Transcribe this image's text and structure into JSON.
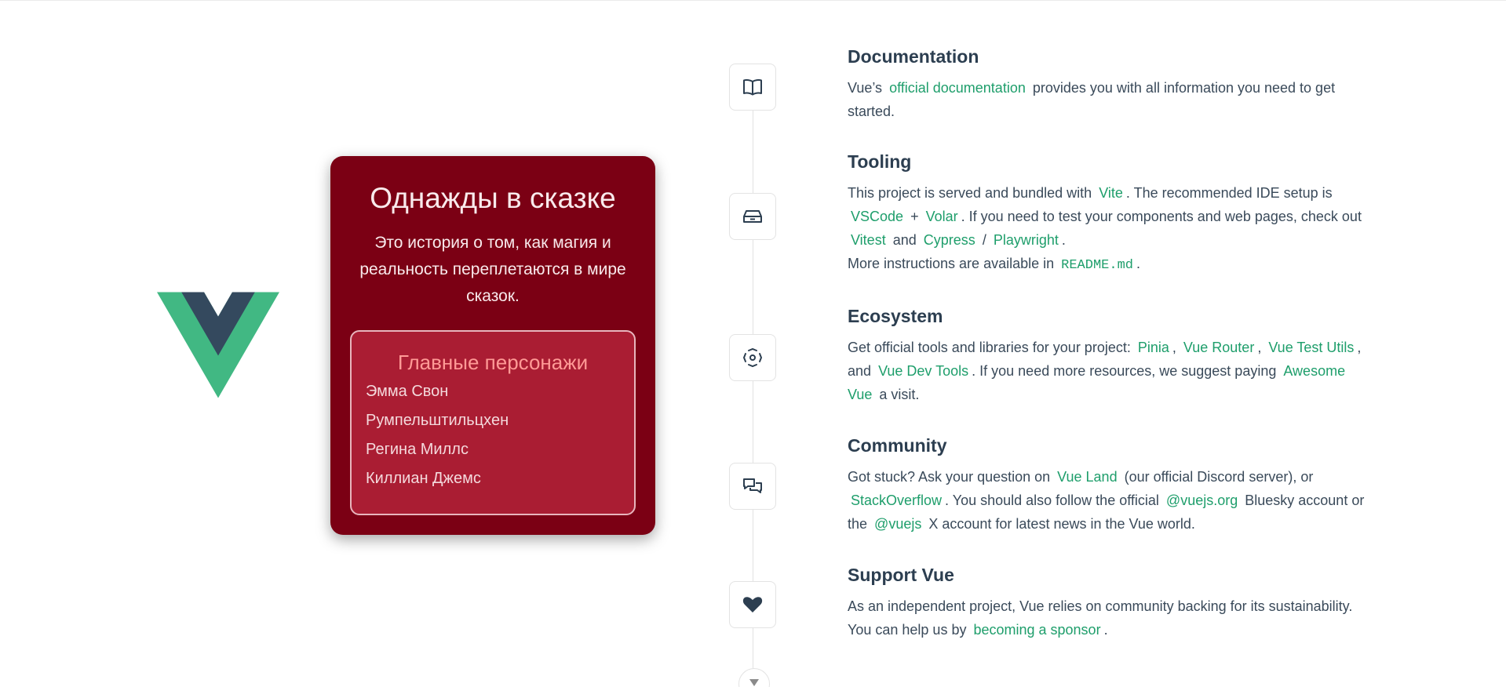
{
  "story": {
    "title": "Однажды в сказке",
    "description": "Это история о том, как магия и реальность переплетаются в мире сказок.",
    "characters_title": "Главные персонажи",
    "characters": [
      "Эмма Свон",
      "Румпельштильцхен",
      "Регина Миллс",
      "Киллиан Джемс"
    ]
  },
  "colors": {
    "card_bg": "#7b0014",
    "card_inner_bg": "#aa1d33",
    "characters_title": "#ff9a96",
    "link": "#1e9e6b",
    "heading": "#2c3e50",
    "vue_green": "#41b883",
    "vue_dark": "#34495e"
  },
  "icons": {
    "documentation": "book-icon",
    "tooling": "tools-icon",
    "ecosystem": "ecosystem-icon",
    "community": "chat-icon",
    "support": "heart-icon",
    "scroll": "chevron-down-icon"
  },
  "documentation": {
    "heading": "Documentation",
    "t1": "Vue’s",
    "link_docs": "official documentation",
    "t2": "provides you with all information you need to get started."
  },
  "tooling": {
    "heading": "Tooling",
    "t1": "This project is served and bundled with",
    "link_vite": "Vite",
    "t2": ". The recommended IDE setup is",
    "link_vscode": "VSCode",
    "t3": "+",
    "link_volar": "Volar",
    "t4": ". If you need to test your components and web pages, check out",
    "link_vitest": "Vitest",
    "t5": "and",
    "link_cypress": "Cypress",
    "t6": "/",
    "link_playwright": "Playwright",
    "t7": ".",
    "t8": "More instructions are available in",
    "code_readme": "README.md",
    "t9": "."
  },
  "ecosystem": {
    "heading": "Ecosystem",
    "t1": "Get official tools and libraries for your project:",
    "link_pinia": "Pinia",
    "t2": ",",
    "link_router": "Vue Router",
    "t3": ",",
    "link_test_utils": "Vue Test Utils",
    "t4": ", and",
    "link_devtools": "Vue Dev Tools",
    "t5": ". If you need more resources, we suggest paying",
    "link_awesome": "Awesome Vue",
    "t6": "a visit."
  },
  "community": {
    "heading": "Community",
    "t1": "Got stuck? Ask your question on",
    "link_vueland": "Vue Land",
    "t2": "(our official Discord server), or",
    "link_stackoverflow": "StackOverflow",
    "t3": ". You should also follow the official",
    "link_bluesky": "@vuejs.org",
    "t4": "Bluesky account or the",
    "link_x": "@vuejs",
    "t5": "X account for latest news in the Vue world."
  },
  "support": {
    "heading": "Support Vue",
    "t1": "As an independent project, Vue relies on community backing for its sustainability. You can help us by",
    "link_sponsor": "becoming a sponsor",
    "t2": "."
  }
}
